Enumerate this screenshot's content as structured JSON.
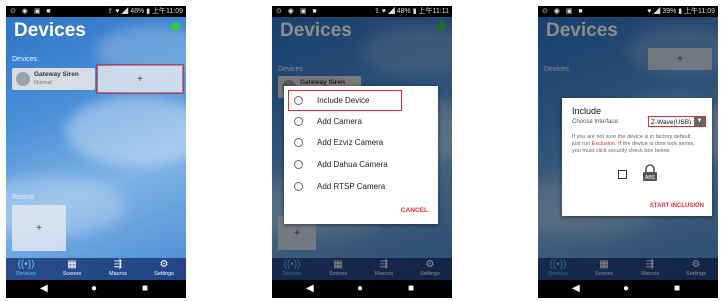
{
  "status": {
    "left_icons": "⊙ ◉ ▣ ■",
    "phone1": "⇪ ♥ ◢ 48% ▮ 上午11:09",
    "phone2": "⇪ ♥ ◢ 48% ▮ 上午11:11",
    "phone3": "♥ ◢ 39% ▮ 上午11:09"
  },
  "app": {
    "title": "Devices",
    "devices_label": "Devices",
    "rooms_label": "Rooms",
    "add_symbol": "+",
    "device": {
      "name": "Gateway Siren",
      "status": "Normal"
    }
  },
  "nav": [
    {
      "label": "Devices",
      "icon": "((•))"
    },
    {
      "label": "Scenes",
      "icon": "▦"
    },
    {
      "label": "Macros",
      "icon": "⇶"
    },
    {
      "label": "Settings",
      "icon": "⚙"
    }
  ],
  "system_nav": {
    "back": "◀",
    "home": "●",
    "recent": "■"
  },
  "add_dialog": {
    "options": [
      "Include Device",
      "Add Camera",
      "Add Ezviz Camera",
      "Add Dahua Camera",
      "Add RTSP Camera"
    ],
    "cancel": "CANCEL"
  },
  "include_dialog": {
    "title": "Include",
    "interface_label": "Choose Interface:",
    "interface_value": "Z-Wave(USB)",
    "text_before": "If you are not sure the device is in factory default, just run ",
    "link": "Exclusion",
    "text_after": ". If the device is door lock series, you must click security check box below.",
    "lock_label": "ABS",
    "start": "START INCLUSION"
  },
  "colors": {
    "accent_red": "#e0302f",
    "status_green": "#2ecc40",
    "nav_active": "#5ac8ff"
  }
}
